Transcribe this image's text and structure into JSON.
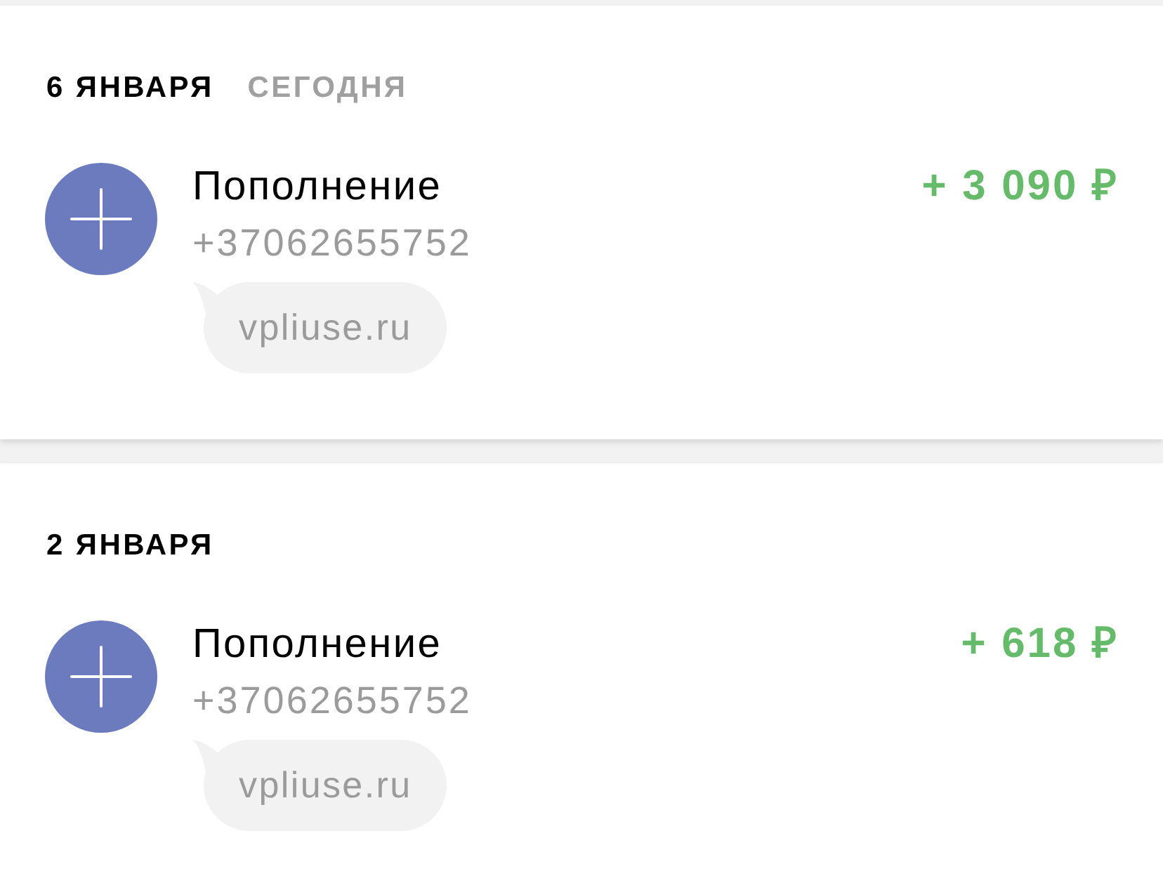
{
  "sections": [
    {
      "date": "6 ЯНВАРЯ",
      "relative_date": "СЕГОДНЯ",
      "transactions": [
        {
          "title": "Пополнение",
          "account": "+37062655752",
          "comment": "vpliuse.ru",
          "amount": "+ 3 090 ₽"
        }
      ]
    },
    {
      "date": "2 ЯНВАРЯ",
      "transactions": [
        {
          "title": "Пополнение",
          "account": "+37062655752",
          "comment": "vpliuse.ru",
          "amount": "+ 618 ₽"
        }
      ]
    }
  ]
}
